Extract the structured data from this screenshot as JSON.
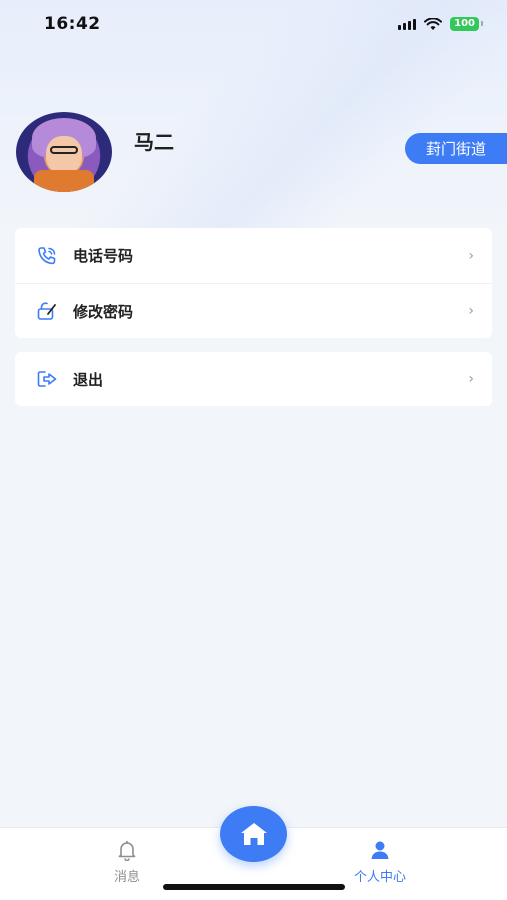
{
  "status": {
    "time": "16:42",
    "battery": "100"
  },
  "profile": {
    "name": "马二",
    "street": "葑门街道"
  },
  "menu": [
    {
      "label": "电话号码",
      "icon": "phone-icon"
    },
    {
      "label": "修改密码",
      "icon": "edit-lock-icon"
    }
  ],
  "logout": {
    "label": "退出",
    "icon": "logout-icon"
  },
  "tabbar": {
    "messages": "消息",
    "profile": "个人中心",
    "home_icon": "home-icon"
  },
  "colors": {
    "accent": "#3d7cf5",
    "background": "#f2f5f9"
  }
}
